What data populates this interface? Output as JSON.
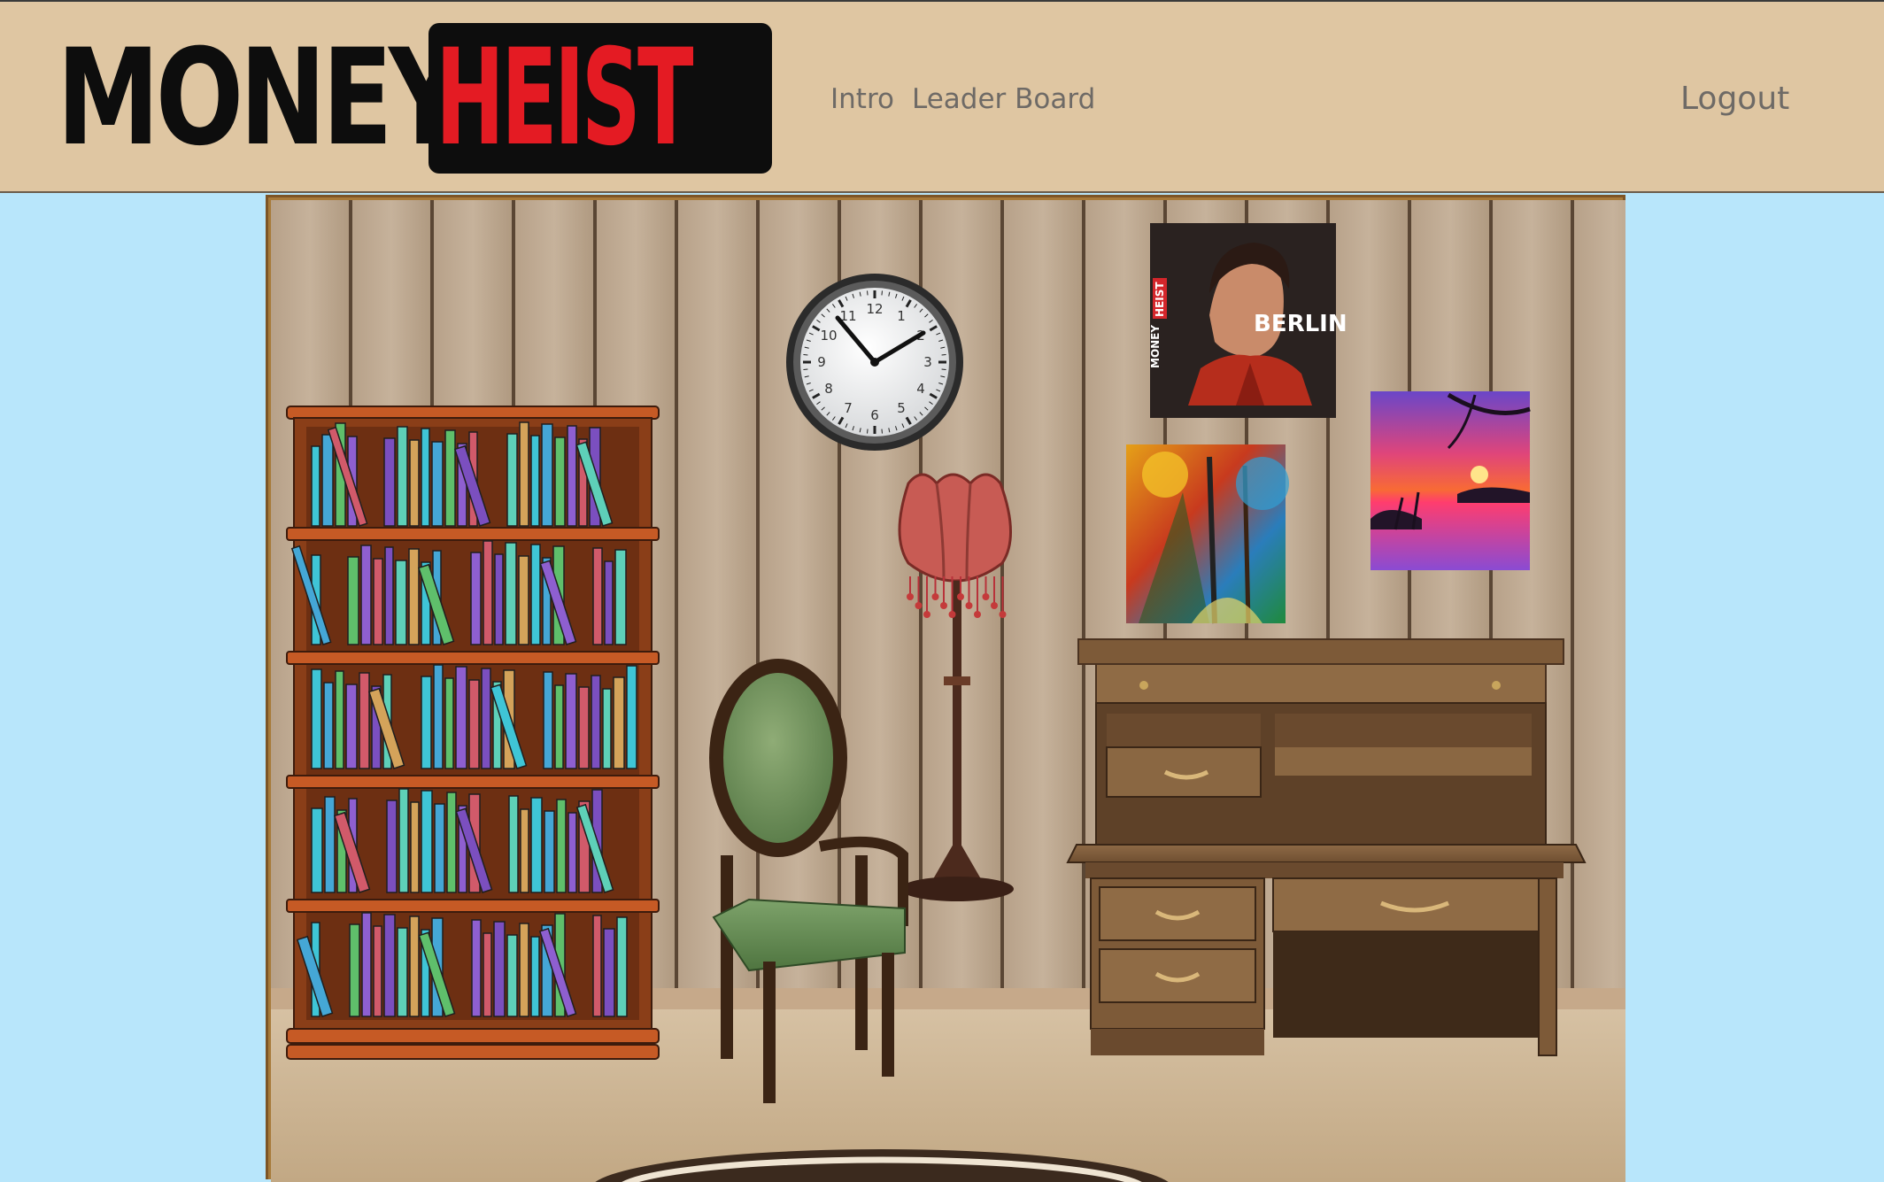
{
  "header": {
    "logo": {
      "word1": "MONEY",
      "word2": "HEIST"
    },
    "nav": {
      "intro": "Intro",
      "leader_board": "Leader Board",
      "logout": "Logout"
    }
  },
  "room": {
    "poster_berlin": {
      "brand_money": "MONEY",
      "brand_heist": "HEIST",
      "name": "BERLIN"
    },
    "clock": {
      "numerals": [
        "12",
        "1",
        "2",
        "3",
        "4",
        "5",
        "6",
        "7",
        "8",
        "9",
        "10",
        "11"
      ],
      "time": "10:09"
    }
  },
  "colors": {
    "header_bg": "#dfc6a2",
    "page_bg": "#b8e6fb",
    "logo_red": "#e41b23",
    "nav_text": "#6e6a66"
  }
}
